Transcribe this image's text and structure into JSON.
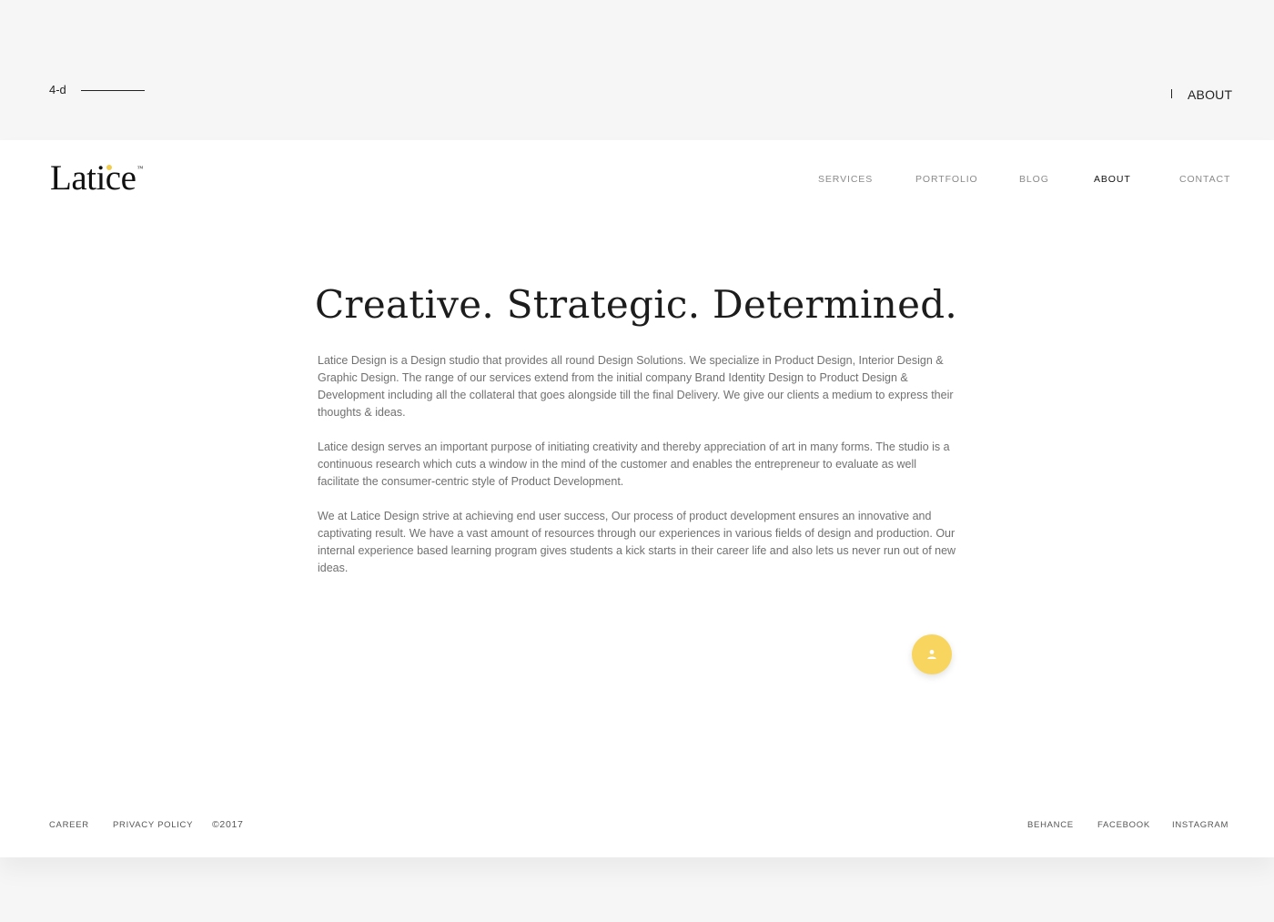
{
  "slide": {
    "number": "4-d",
    "title": "ABOUT"
  },
  "brand": {
    "name": "Latice",
    "trademark": "™",
    "accent_color": "#f2cc4a"
  },
  "nav": {
    "items": [
      {
        "label": "SERVICES",
        "active": false
      },
      {
        "label": "PORTFOLIO",
        "active": false
      },
      {
        "label": "BLOG",
        "active": false
      },
      {
        "label": "ABOUT",
        "active": true
      },
      {
        "label": "CONTACT",
        "active": false
      }
    ]
  },
  "content": {
    "headline": "Creative. Strategic. Determined.",
    "paragraphs": [
      "Latice Design is a Design studio that provides all round Design Solutions. We specialize in Product Design, Interior Design & Graphic Design. The range of our services extend from the initial company Brand Identity Design to Product Design & Development including all the collateral that goes alongside till the final Delivery. We give our clients a medium to express their thoughts & ideas.",
      "Latice design serves an important purpose of initiating creativity and thereby appreciation of art in many forms. The studio is a continuous research which cuts a window in the mind of the customer and enables the entrepreneur to evaluate as well facilitate the consumer-centric style of Product Development.",
      "We at Latice Design strive at achieving end user success, Our process of product development ensures an innovative and captivating result. We have a vast amount of resources through our experiences in various fields of design and production. Our internal experience based learning program gives students a kick starts in their career life and also lets us never run out of new ideas."
    ]
  },
  "fab": {
    "icon": "user-icon",
    "color": "#f7d55e"
  },
  "footer": {
    "left": [
      {
        "label": "CAREER"
      },
      {
        "label": "PRIVACY POLICY"
      }
    ],
    "copyright": "©2017",
    "social": [
      {
        "label": "BEHANCE"
      },
      {
        "label": "FACEBOOK"
      },
      {
        "label": "INSTAGRAM"
      }
    ]
  }
}
